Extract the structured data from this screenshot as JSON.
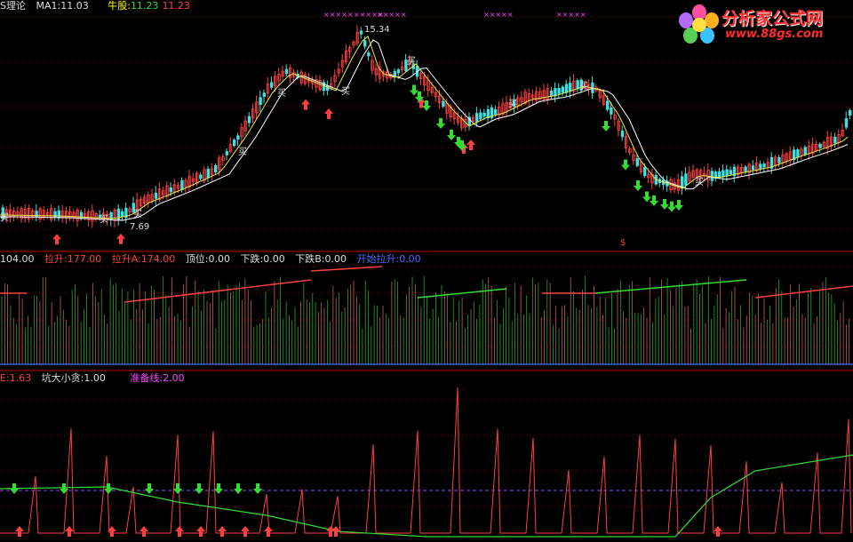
{
  "panel1": {
    "title": "S理论",
    "ma1_label": "MA1:",
    "ma1_value": "11.03",
    "niugu_label": "牛股:",
    "niugu_v1": "11.23",
    "niugu_v2": "11.23",
    "peak_label": "15.34",
    "low_label": "7.69",
    "buy_label": "买",
    "marker_s": "$",
    "marks_top": "×××××"
  },
  "panel2": {
    "v0": "104.00",
    "lashen_label": "拉升:",
    "lashen_value": "177.00",
    "lashenA_label": "拉升A:",
    "lashenA_value": "174.00",
    "dingwei_label": "顶位:",
    "dingwei_value": "0.00",
    "xiadie_label": "下跌:",
    "xiadie_value": "0.00",
    "xiadieB_label": "下跌B:",
    "xiadieB_value": "0.00",
    "kaishi_label": "开始拉升:",
    "kaishi_value": "0.00"
  },
  "panel3": {
    "e_label": "E:",
    "e_value": "1.63",
    "kengda_label": "坑大小贪:",
    "kengda_value": "1.00",
    "zhunbei_label": "准备线:",
    "zhunbei_value": "2.00"
  },
  "logo": {
    "name": "分析家公式网",
    "url": "www.88gs.com"
  },
  "colors": {
    "up": "#ff4040",
    "down": "#40e0e0",
    "green": "#33dd33",
    "magenta": "#ff44ff",
    "yellow": "#ffff00",
    "blue": "#4a6cff",
    "grid": "#8b0000"
  }
}
